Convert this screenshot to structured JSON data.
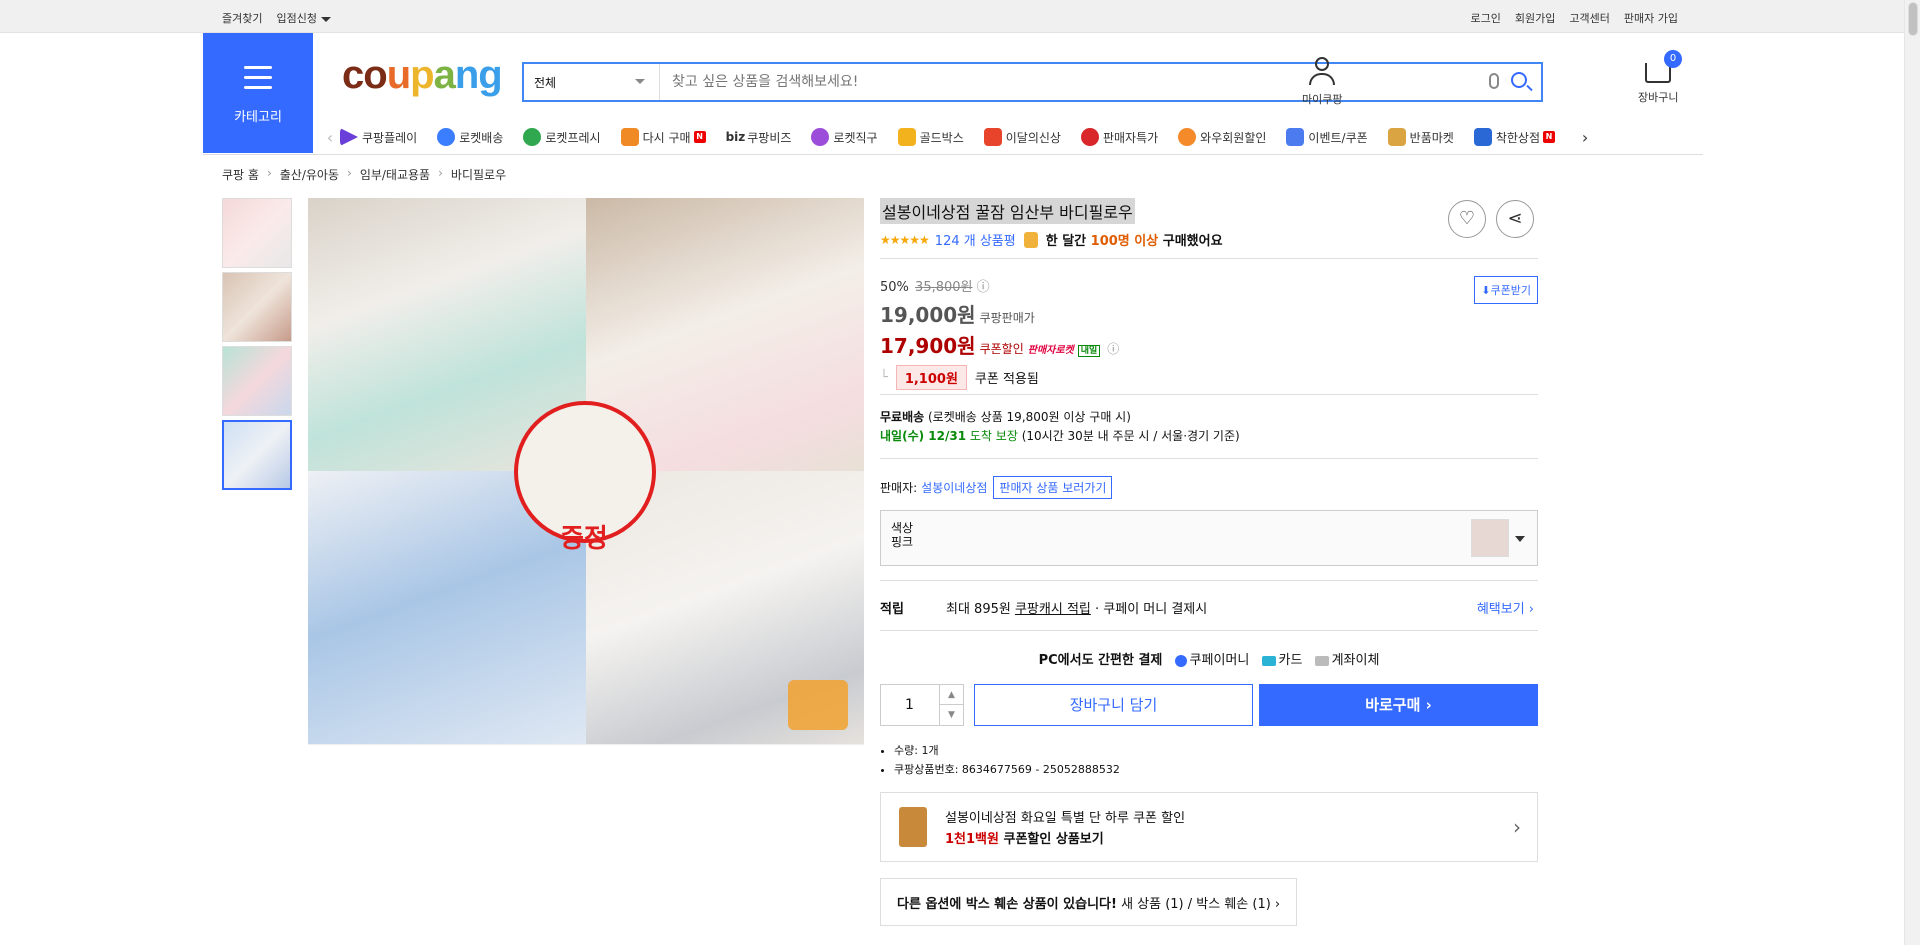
{
  "topbar": {
    "left": [
      "즐겨찾기",
      "입점신청"
    ],
    "right": [
      "로그인",
      "회원가입",
      "고객센터",
      "판매자 가입"
    ]
  },
  "header": {
    "category_label": "카테고리",
    "logo": {
      "c": "c",
      "o": "o",
      "u": "u",
      "p": "p",
      "a": "a",
      "n": "n",
      "g": "g"
    },
    "search": {
      "scope": "전체",
      "placeholder": "찾고 싶은 상품을 검색해보세요!"
    },
    "mycoupang": "마이쿠팡",
    "cart": "장바구니",
    "cart_count": "0"
  },
  "nav": {
    "items": [
      "쿠팡플레이",
      "로켓배송",
      "로켓프레시",
      "다시 구매",
      "쿠팡비즈",
      "로켓직구",
      "골드박스",
      "이달의신상",
      "판매자특가",
      "와우회원할인",
      "이벤트/쿠폰",
      "반품마켓",
      "착한상점"
    ],
    "biz_prefix": "biz",
    "new_badge": "N"
  },
  "breadcrumb": [
    "쿠팡 홈",
    "출산/유아동",
    "임부/태교용품",
    "바디필로우"
  ],
  "product": {
    "title": "설봉이네상점 꿀잠 임산부 바디필로우",
    "stars": "★★★★★",
    "reviews": "124 개 상품평",
    "bought_a": "한 달간",
    "bought_b": "100명 이상",
    "bought_c": "구매했어요",
    "gift_label": "증정",
    "discount_rate": "50%",
    "original_price": "35,800원",
    "price": "19,000원",
    "price_note": "쿠팡판매가",
    "coupon_price": "17,900원",
    "coupon_note": "쿠폰할인",
    "rocket_label": "판매자로켓",
    "tomorrow_label": "내일",
    "coupon_amount": "1,100원",
    "coupon_applied": "쿠폰 적용됨",
    "coupon_button": "쿠폰받기"
  },
  "shipping": {
    "free_label": "무료배송",
    "free_note": "(로켓배송 상품 19,800원 이상 구매 시)",
    "arrive": "내일(수) 12/31",
    "arrive_note": "도착 보장",
    "arrive_cond": "(10시간 30분 내 주문 시 / 서울·경기 기준)"
  },
  "seller": {
    "label": "판매자:",
    "name": "설봉이네상점",
    "button": "판매자 상품 보러가기"
  },
  "option": {
    "label": "색상",
    "value": "핑크"
  },
  "points": {
    "label": "적립",
    "text1": "최대 895원",
    "text2": "쿠팡캐시 적립",
    "text3": "· 쿠페이 머니 결제시",
    "more": "혜택보기 ›"
  },
  "pcpay": {
    "text": "PC에서도 간편한 결제",
    "m1": "쿠페이머니",
    "m2": "카드",
    "m3": "계좌이체"
  },
  "buy": {
    "qty": "1",
    "cart_button": "장바구니 담기",
    "buy_button": "바로구매 ›"
  },
  "details": [
    "수량: 1개",
    "쿠팡상품번호: 8634677569 - 25052888532"
  ],
  "promo": {
    "line1": "설봉이네상점 화요일 특별 단 하루 쿠폰 할인",
    "amount": "1천1백원",
    "line2": "쿠폰할인 상품보기"
  },
  "box_notice": {
    "bold": "다른 옵션에 박스 훼손 상품이 있습니다!",
    "rest": "새 상품 (1) / 박스 훼손 (1) ›"
  },
  "colors": {
    "accent": "#346aff",
    "price_red": "#ae0000",
    "green": "#0a8a0a"
  }
}
